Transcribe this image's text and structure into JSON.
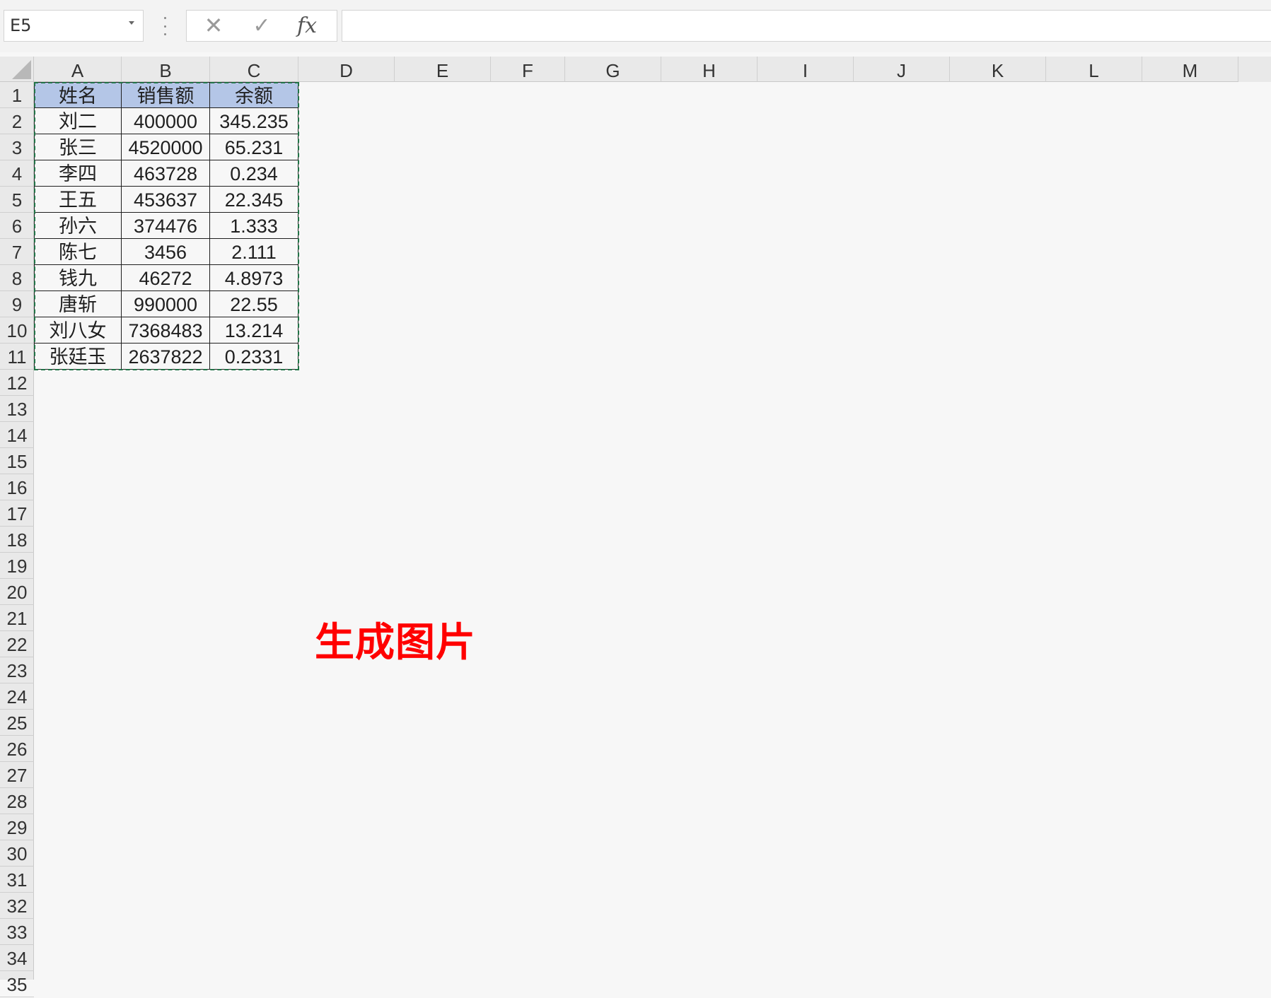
{
  "formula_bar": {
    "name_box": "E5",
    "formula": ""
  },
  "icons": {
    "cancel": "✕",
    "confirm": "✓",
    "fx": "fx"
  },
  "columns": [
    "A",
    "B",
    "C",
    "D",
    "E",
    "F",
    "G",
    "H",
    "I",
    "J",
    "K",
    "L",
    "M"
  ],
  "rows": [
    "1",
    "2",
    "3",
    "4",
    "5",
    "6",
    "7",
    "8",
    "9",
    "10",
    "11",
    "12",
    "13",
    "14",
    "15",
    "16",
    "17",
    "18",
    "19",
    "20",
    "21",
    "22",
    "23",
    "24",
    "25",
    "26",
    "27",
    "28",
    "29",
    "30",
    "31",
    "32",
    "33",
    "34",
    "35"
  ],
  "table": {
    "headers": [
      "姓名",
      "销售额",
      "余额"
    ],
    "rows": [
      [
        "刘二",
        "400000",
        "345.235"
      ],
      [
        "张三",
        "4520000",
        "65.231"
      ],
      [
        "李四",
        "463728",
        "0.234"
      ],
      [
        "王五",
        "453637",
        "22.345"
      ],
      [
        "孙六",
        "374476",
        "1.333"
      ],
      [
        "陈七",
        "3456",
        "2.111"
      ],
      [
        "钱九",
        "46272",
        "4.8973"
      ],
      [
        "唐斩",
        "990000",
        "22.55"
      ],
      [
        "刘八女",
        "7368483",
        "13.214"
      ],
      [
        "张廷玉",
        "2637822",
        "0.2331"
      ]
    ]
  },
  "annotation": "生成图片",
  "colors": {
    "header_fill": "#b4c6e7",
    "annotation": "#ff0000",
    "copy_marquee": "#217346"
  }
}
